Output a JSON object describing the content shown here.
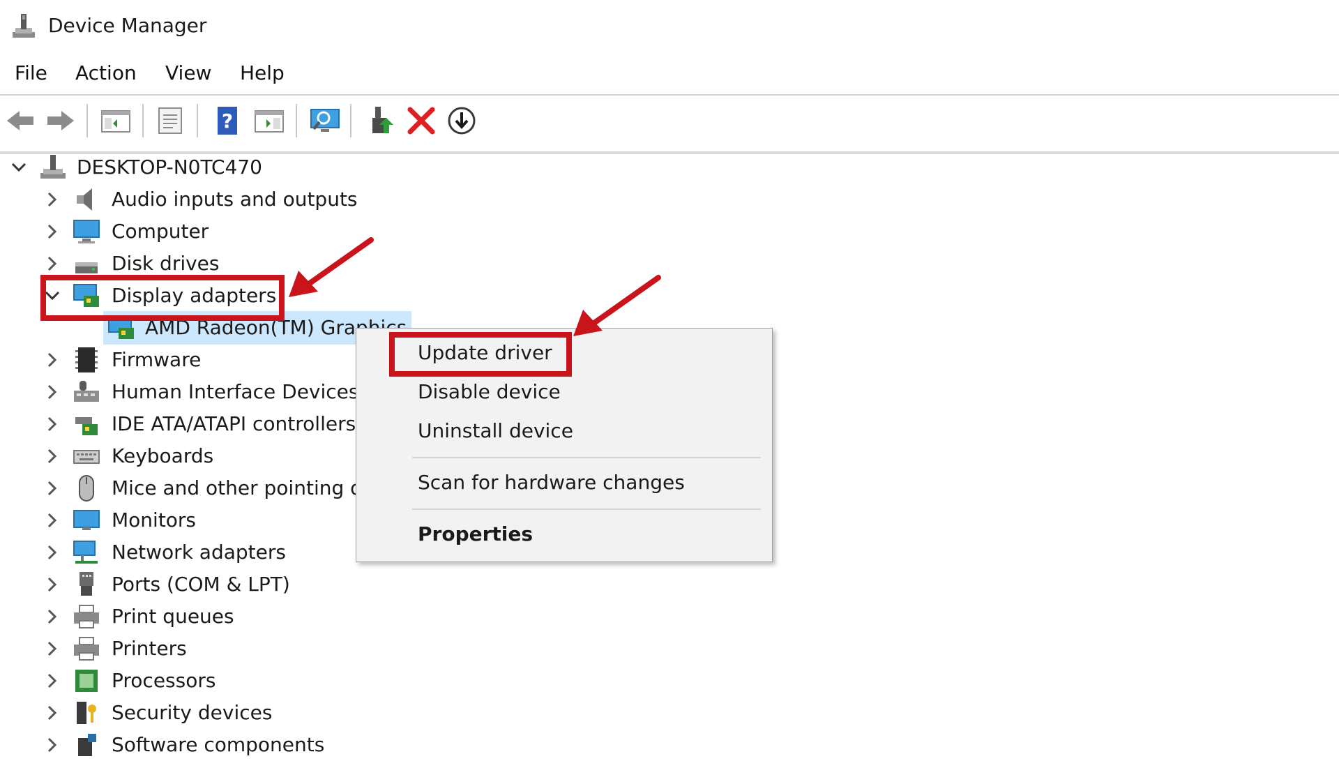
{
  "window": {
    "title": "Device Manager"
  },
  "menu": [
    "File",
    "Action",
    "View",
    "Help"
  ],
  "toolbar": {
    "buttons": [
      "back-icon",
      "forward-icon",
      "show-hide-console-tree-icon",
      "properties-icon",
      "help-icon",
      "show-action-pane-icon",
      "scan-hardware-icon",
      "update-driver-icon",
      "uninstall-icon",
      "disable-device-icon"
    ]
  },
  "tree": {
    "root": "DESKTOP-N0TC470",
    "items": [
      {
        "label": "Audio inputs and outputs",
        "icon": "speaker-icon"
      },
      {
        "label": "Computer",
        "icon": "computer-icon"
      },
      {
        "label": "Disk drives",
        "icon": "disk-drive-icon"
      },
      {
        "label": "Display adapters",
        "icon": "display-adapter-icon",
        "expanded": true
      },
      {
        "label": "AMD Radeon(TM) Graphics",
        "icon": "display-adapter-icon",
        "child": true,
        "selected": true
      },
      {
        "label": "Firmware",
        "icon": "firmware-icon"
      },
      {
        "label": "Human Interface Devices",
        "icon": "hid-icon"
      },
      {
        "label": "IDE ATA/ATAPI controllers",
        "icon": "ide-controller-icon"
      },
      {
        "label": "Keyboards",
        "icon": "keyboard-icon"
      },
      {
        "label": "Mice and other pointing devices",
        "icon": "mouse-icon"
      },
      {
        "label": "Monitors",
        "icon": "monitor-icon"
      },
      {
        "label": "Network adapters",
        "icon": "network-adapter-icon"
      },
      {
        "label": "Ports (COM & LPT)",
        "icon": "port-icon"
      },
      {
        "label": "Print queues",
        "icon": "printer-icon"
      },
      {
        "label": "Printers",
        "icon": "printer-icon"
      },
      {
        "label": "Processors",
        "icon": "processor-icon"
      },
      {
        "label": "Security devices",
        "icon": "security-device-icon"
      },
      {
        "label": "Software components",
        "icon": "software-component-icon"
      }
    ]
  },
  "context_menu": {
    "items": [
      {
        "label": "Update driver"
      },
      {
        "label": "Disable device"
      },
      {
        "label": "Uninstall device"
      },
      {
        "label": "Scan for hardware changes"
      },
      {
        "label": "Properties"
      }
    ]
  },
  "colors": {
    "annotation": "#c8141a",
    "selection": "#cce8ff",
    "menu_bg": "#f2f2f2"
  }
}
